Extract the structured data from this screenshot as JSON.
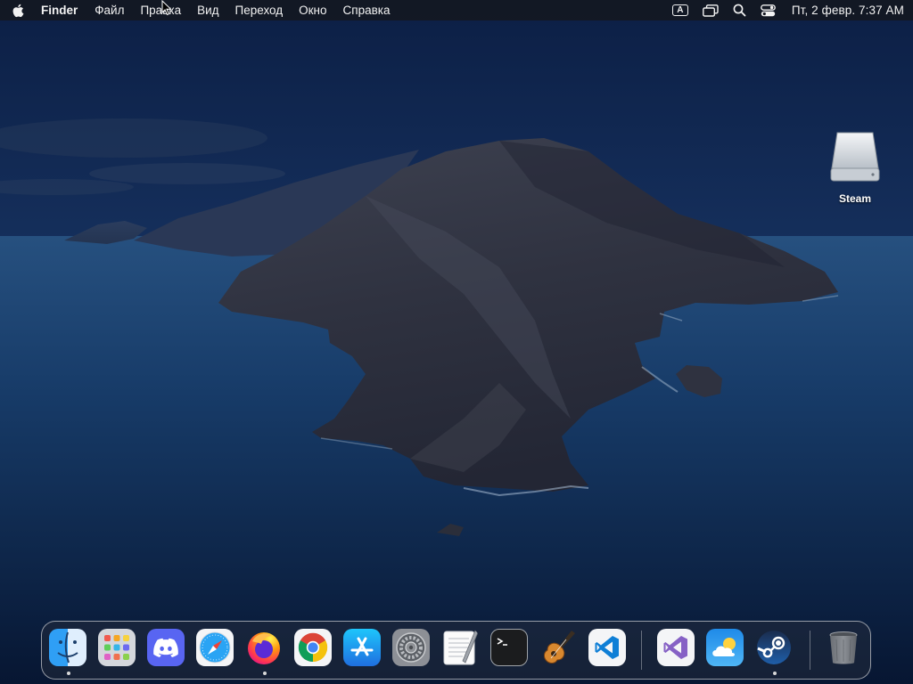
{
  "menubar": {
    "apple_icon": "apple-logo",
    "app_name": "Finder",
    "menus": [
      "Файл",
      "Правка",
      "Вид",
      "Переход",
      "Окно",
      "Справка"
    ],
    "status_icons": [
      "keyboard-input-icon",
      "screen-mirroring-icon",
      "spotlight-search-icon",
      "control-center-icon"
    ],
    "input_source": "A",
    "clock": "Пт, 2 февр.  7:37 AM"
  },
  "desktop": {
    "icons": [
      {
        "label": "Steam",
        "icon": "external-drive-icon"
      }
    ]
  },
  "dock": {
    "apps": [
      {
        "name": "Finder",
        "icon": "finder-icon",
        "running": true
      },
      {
        "name": "Launchpad",
        "icon": "launchpad-icon",
        "running": false
      },
      {
        "name": "Discord",
        "icon": "discord-icon",
        "running": false
      },
      {
        "name": "Safari",
        "icon": "safari-icon",
        "running": false
      },
      {
        "name": "Firefox",
        "icon": "firefox-icon",
        "running": true
      },
      {
        "name": "Google Chrome",
        "icon": "chrome-icon",
        "running": false
      },
      {
        "name": "App Store",
        "icon": "app-store-icon",
        "running": false
      },
      {
        "name": "System Preferences",
        "icon": "system-preferences-icon",
        "running": false
      },
      {
        "name": "TextEdit",
        "icon": "textedit-icon",
        "running": false
      },
      {
        "name": "Terminal",
        "icon": "terminal-icon",
        "running": false
      },
      {
        "name": "GarageBand",
        "icon": "garageband-icon",
        "running": false
      },
      {
        "name": "Visual Studio Code",
        "icon": "vscode-icon",
        "running": false
      },
      {
        "name": "Visual Studio",
        "icon": "visual-studio-icon",
        "running": false
      },
      {
        "name": "Weather",
        "icon": "weather-icon",
        "running": false
      },
      {
        "name": "Steam",
        "icon": "steam-icon",
        "running": true
      }
    ],
    "trash": {
      "name": "Trash",
      "icon": "trash-icon"
    }
  },
  "colors": {
    "menubar_bg": "#141822",
    "sky_top": "#0f2550",
    "sea": "#0c2447",
    "accent_blue": "#1f6fe0"
  }
}
